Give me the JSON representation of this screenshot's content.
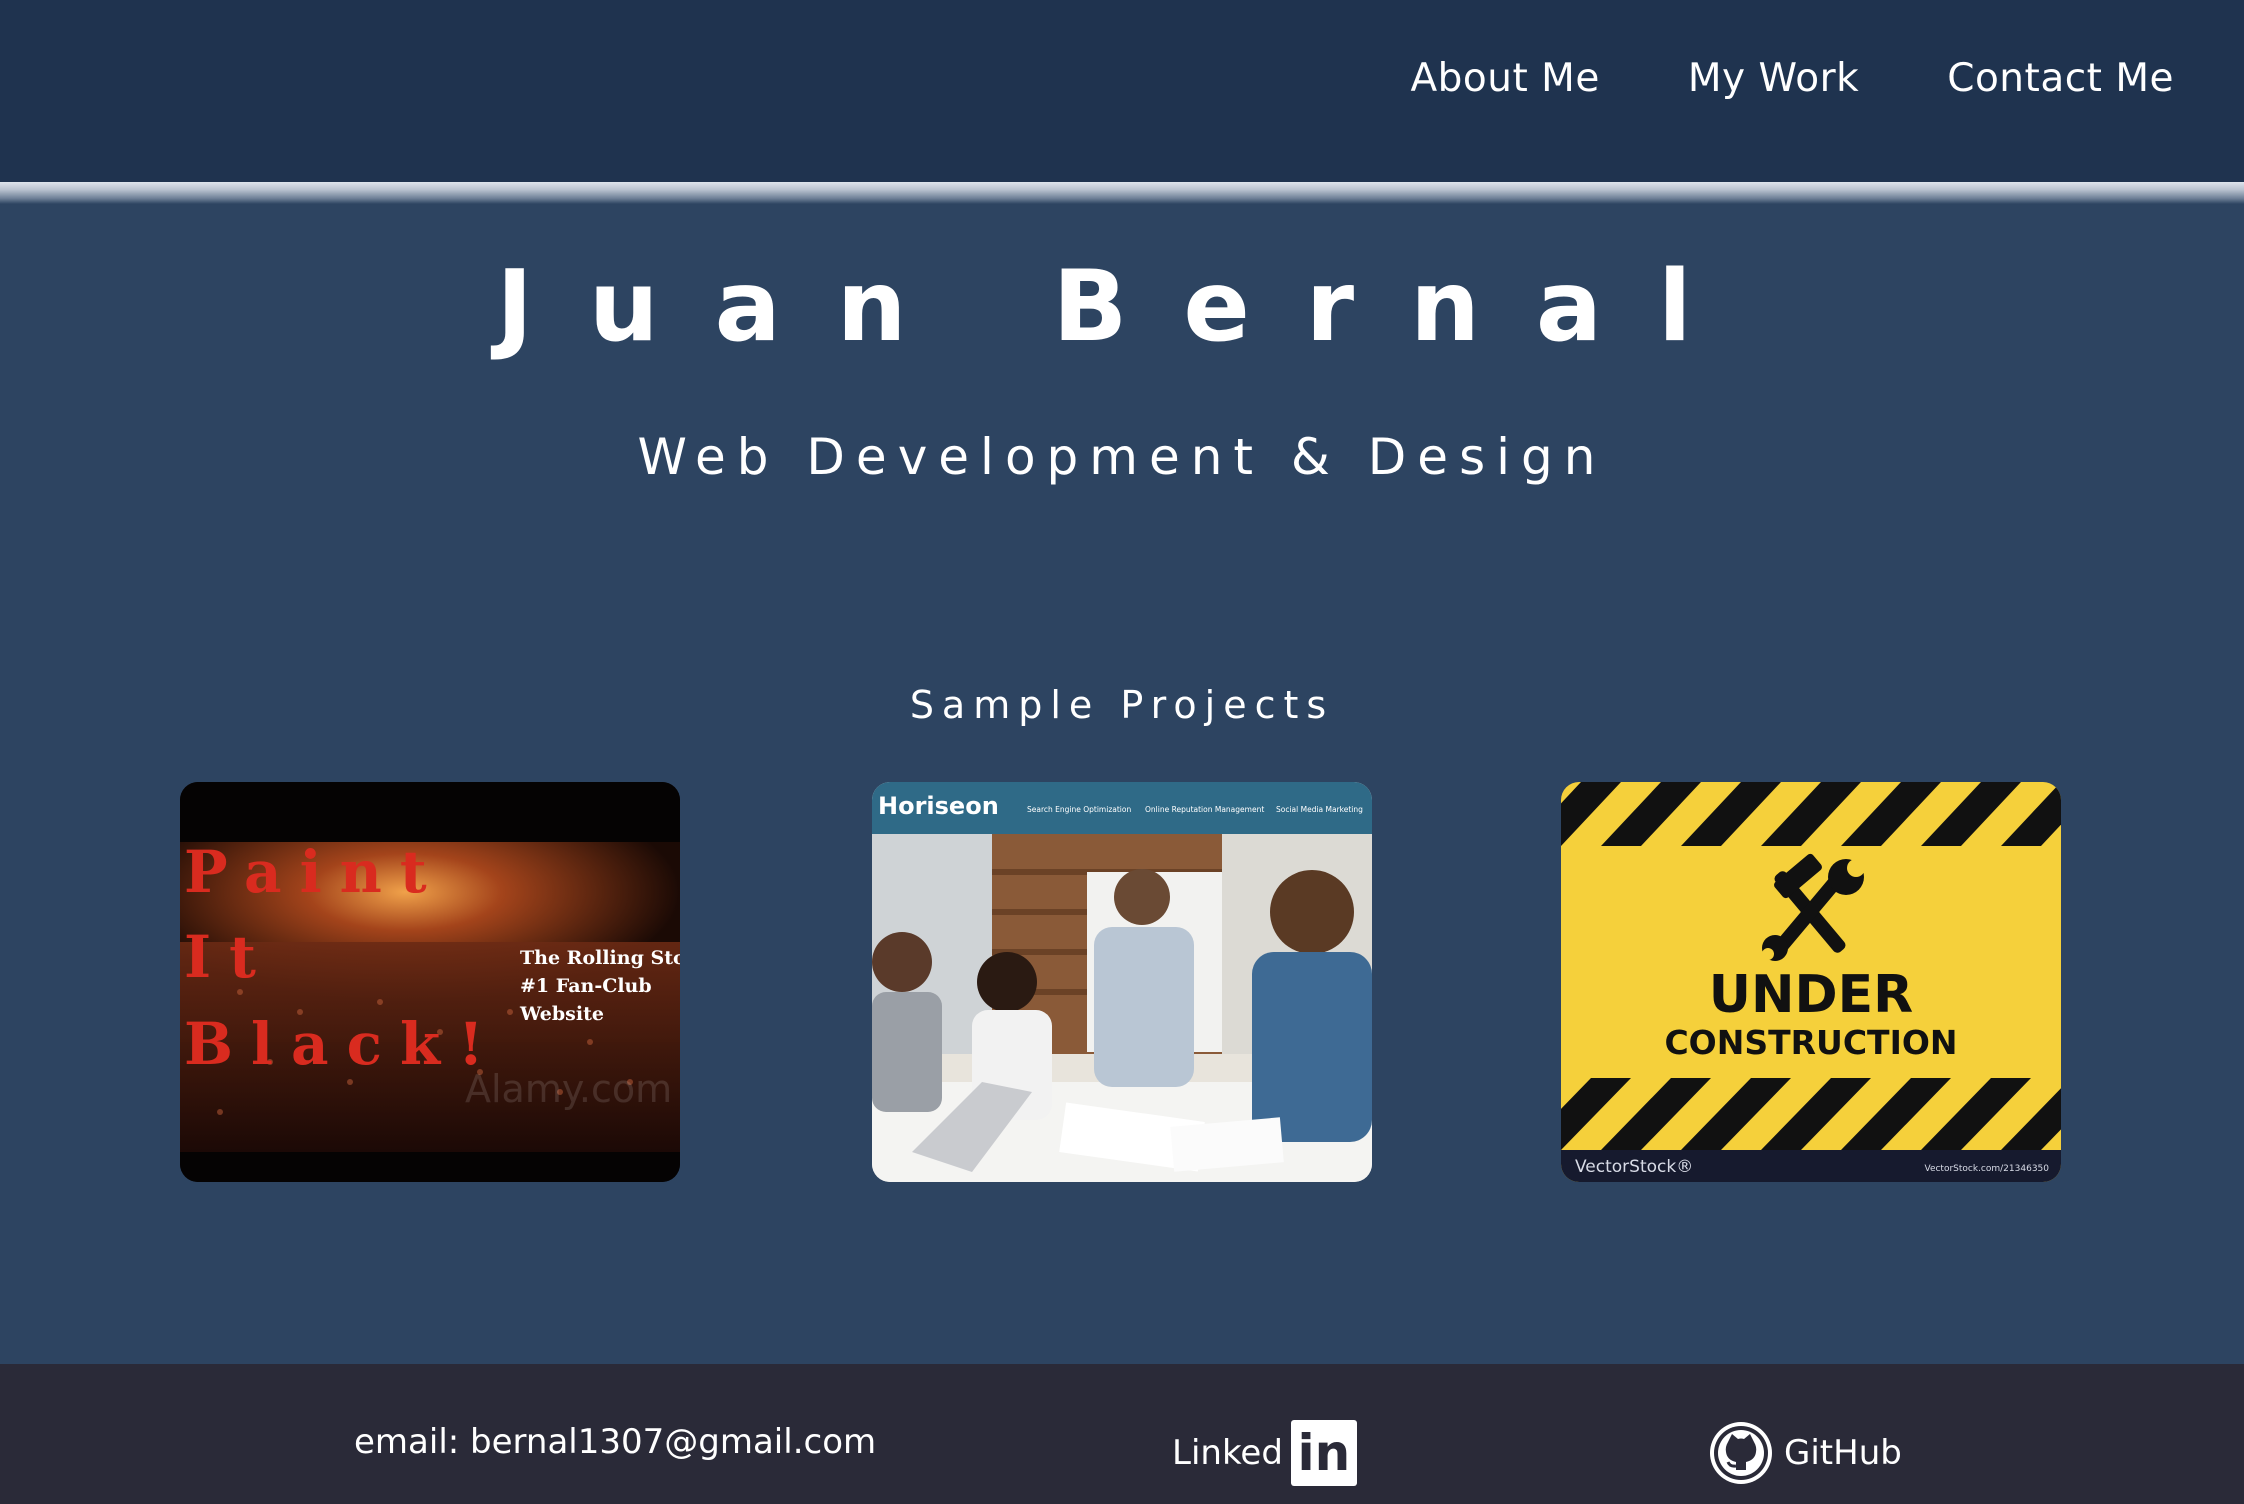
{
  "nav": {
    "items": [
      {
        "label": "About Me"
      },
      {
        "label": "My Work"
      },
      {
        "label": "Contact Me"
      }
    ]
  },
  "hero": {
    "title": "Juan Bernal",
    "subtitle": "Web Development & Design"
  },
  "projects": {
    "heading": "Sample Projects",
    "cards": [
      {
        "image_text": [
          "Paint",
          "It",
          "Black!"
        ],
        "caption_lines": [
          "The Rolling Stones",
          "#1 Fan-Club",
          "Website"
        ],
        "watermark": "Alamy.com"
      },
      {
        "brand": "Horiseon",
        "menu": [
          "Search Engine Optimization",
          "Online Reputation Management",
          "Social Media Marketing"
        ]
      },
      {
        "line1": "UNDER",
        "line2": "CONSTRUCTION",
        "brand": "VectorStock®",
        "url": "VectorStock.com/21346350"
      }
    ]
  },
  "footer": {
    "email": "email: bernal1307@gmail.com",
    "linkedin_label": "Linked",
    "linkedin_badge": "in",
    "github_label": "GitHub"
  },
  "colors": {
    "header_bg": "#1f334f",
    "page_bg": "#2d4461",
    "footer_bg": "#2a2a38",
    "accent_red": "#d92b1f",
    "caution_yellow": "#f5d03b"
  },
  "icons": [
    "github-octocat-icon",
    "linkedin-in-icon",
    "wrench-hammer-icon"
  ]
}
